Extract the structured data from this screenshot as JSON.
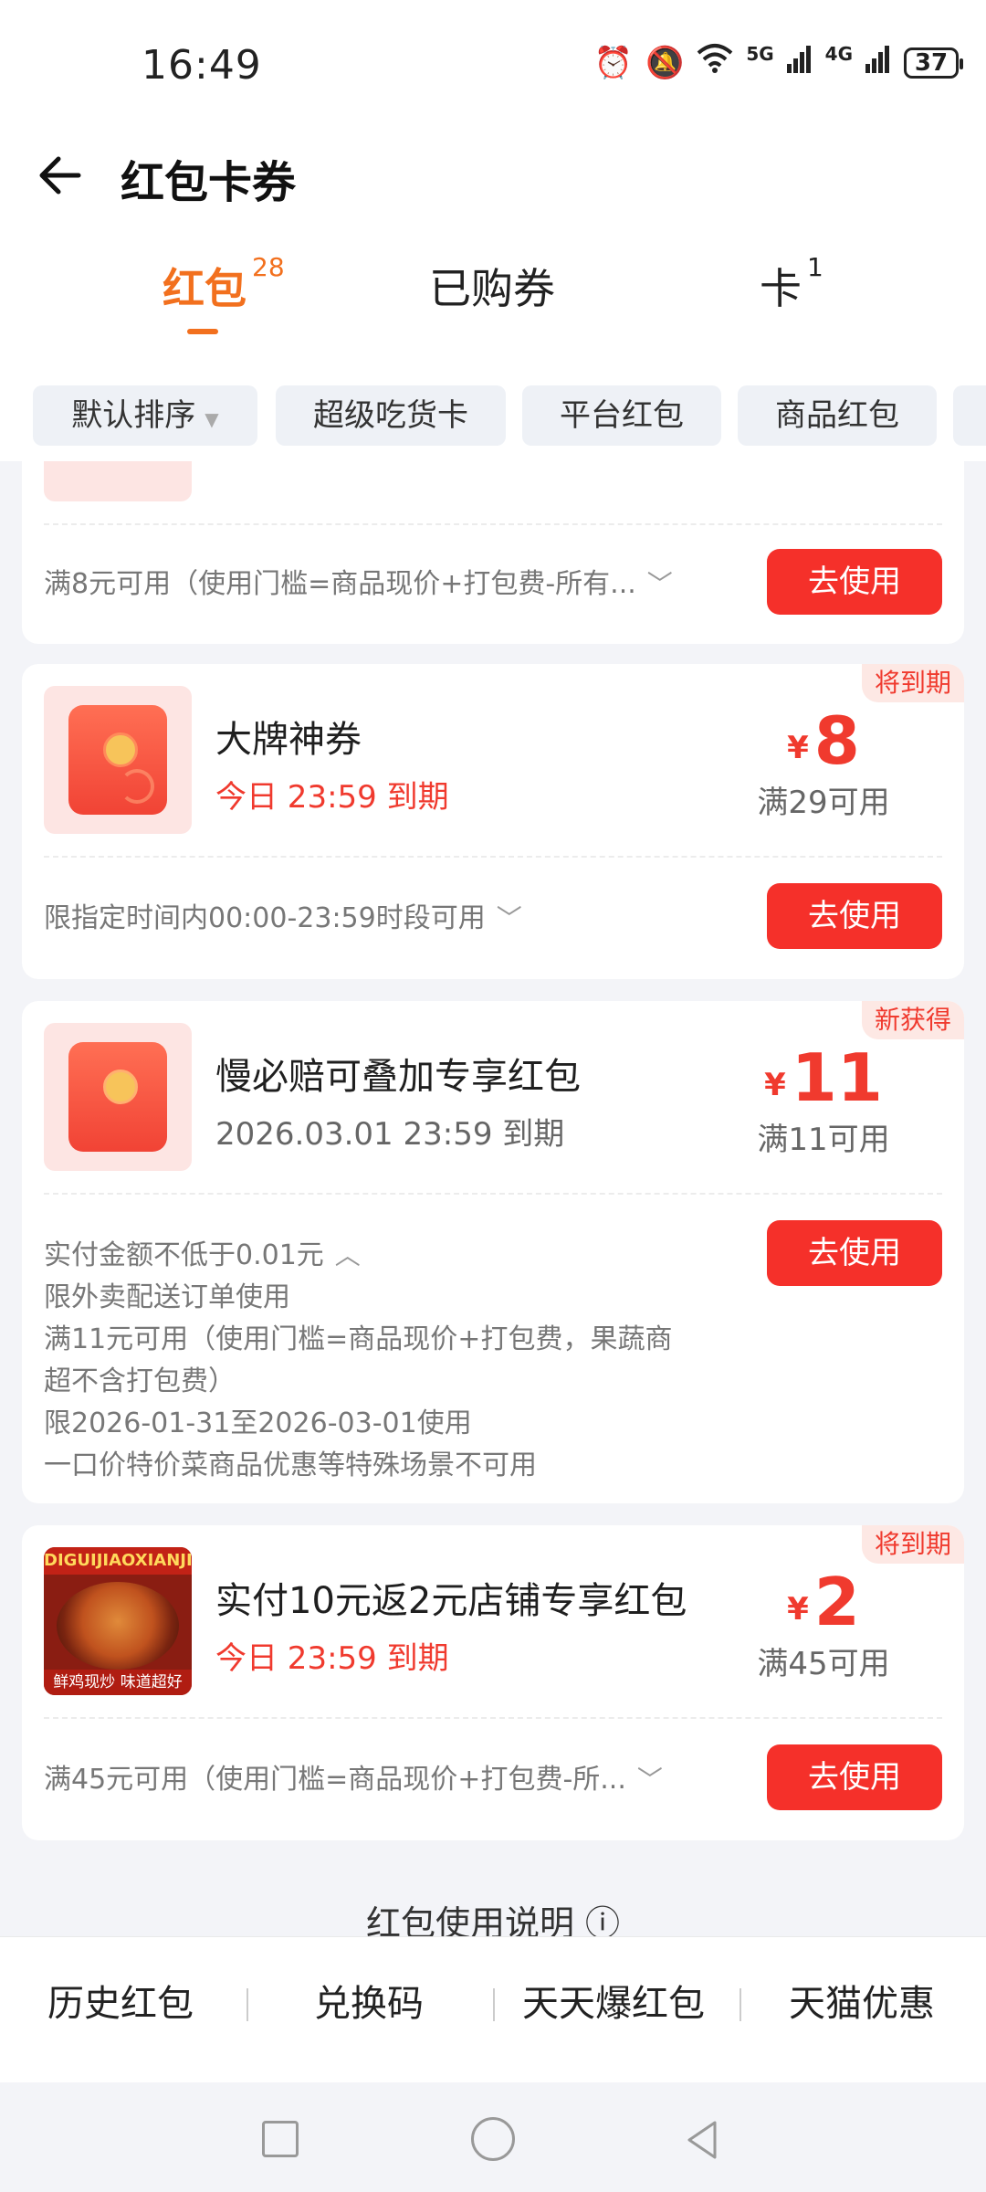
{
  "status_bar": {
    "time": "16:49",
    "network_5g": "5G",
    "network_4g": "4G",
    "battery": "37"
  },
  "header": {
    "title": "红包卡券"
  },
  "tabs": [
    {
      "label": "红包",
      "count": "28"
    },
    {
      "label": "已购券",
      "count": ""
    },
    {
      "label": "卡",
      "count": "1"
    }
  ],
  "filters": [
    {
      "label": "默认排序"
    },
    {
      "label": "超级吃货卡"
    },
    {
      "label": "平台红包"
    },
    {
      "label": "商品红包"
    }
  ],
  "cards": [
    {
      "rule": "满8元可用（使用门槛=商品现价+打包费-所有...",
      "button": "去使用"
    },
    {
      "tag": "将到期",
      "name": "大牌神券",
      "expiry": "今日 23:59 到期",
      "currency": "¥",
      "amount": "8",
      "condition": "满29可用",
      "rule": "限指定时间内00:00-23:59时段可用",
      "button": "去使用"
    },
    {
      "tag": "新获得",
      "name": "慢必赔可叠加专享红包",
      "expiry": "2026.03.01 23:59 到期",
      "currency": "¥",
      "amount": "11",
      "condition": "满11可用",
      "rules": [
        "实付金额不低于0.01元",
        "限外卖配送订单使用",
        "满11元可用（使用门槛=商品现价+打包费，果蔬商",
        "超不含打包费）",
        "限2026-01-31至2026-03-01使用",
        "一口价特价菜商品优惠等特殊场景不可用"
      ],
      "button": "去使用"
    },
    {
      "tag": "将到期",
      "name": "实付10元返2元店铺专享红包",
      "expiry": "今日 23:59 到期",
      "currency": "¥",
      "amount": "2",
      "condition": "满45可用",
      "rule": "满45元可用（使用门槛=商品现价+打包费-所...",
      "button": "去使用",
      "image_top_text": "DIGUIJIAOXIANJI",
      "image_bottom_text": "鲜鸡现炒 味道超好"
    }
  ],
  "footer_peek": "红包使用说明",
  "bottom_bar": [
    {
      "label": "历史红包"
    },
    {
      "label": "兑换码"
    },
    {
      "label": "天天爆红包"
    },
    {
      "label": "天猫优惠"
    }
  ],
  "icons": {
    "back": "arrow-left-icon",
    "alarm": "alarm-icon",
    "mute": "bell-off-icon",
    "wifi": "wifi-icon",
    "envelope": "red-envelope-icon"
  },
  "colors": {
    "accent": "#f2701e",
    "red": "#f03a2e",
    "button": "#f5302a"
  }
}
